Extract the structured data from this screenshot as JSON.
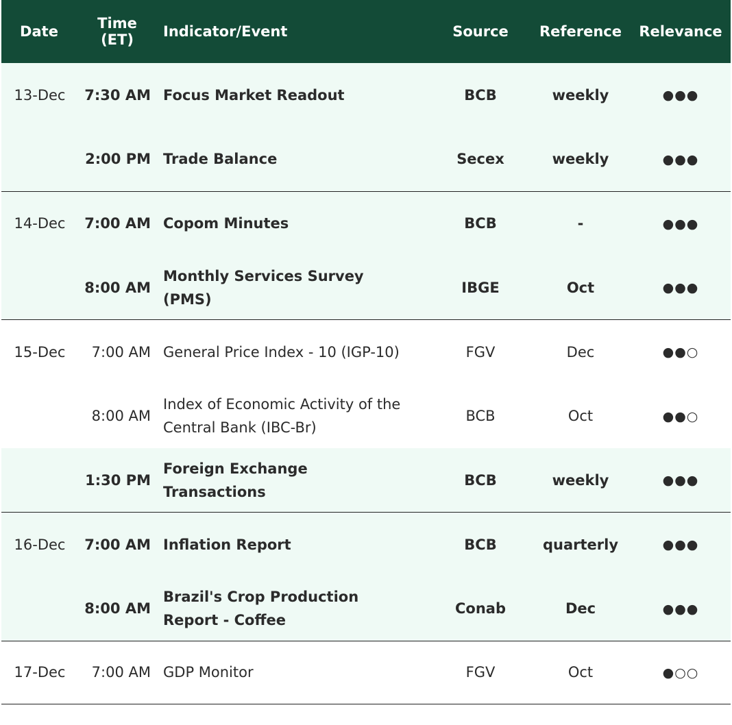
{
  "header": {
    "date": "Date",
    "time": "Time (ET)",
    "indicator": "Indicator/Event",
    "source": "Source",
    "reference": "Reference",
    "relevance": "Relevance"
  },
  "colors": {
    "header_bg": "#134b37",
    "highlight_bg": "#effaf5",
    "text": "#2b2b2b"
  },
  "rows": [
    {
      "date": "13-Dec",
      "time": "7:30 AM",
      "indicator": "Focus Market Readout",
      "source": "BCB",
      "reference": "weekly",
      "relevance": "●●●"
    },
    {
      "date": "",
      "time": "2:00 PM",
      "indicator": "Trade Balance",
      "source": "Secex",
      "reference": "weekly",
      "relevance": "●●●"
    },
    {
      "date": "14-Dec",
      "time": "7:00 AM",
      "indicator": "Copom Minutes",
      "source": "BCB",
      "reference": "-",
      "relevance": "●●●"
    },
    {
      "date": "",
      "time": "8:00 AM",
      "indicator": "Monthly Services Survey (PMS)",
      "source": "IBGE",
      "reference": "Oct",
      "relevance": "●●●"
    },
    {
      "date": "15-Dec",
      "time": "7:00 AM",
      "indicator": "General Price Index - 10 (IGP-10)",
      "source": "FGV",
      "reference": "Dec",
      "relevance": "●●○"
    },
    {
      "date": "",
      "time": "8:00 AM",
      "indicator": "Index of Economic Activity of the Central Bank (IBC-Br)",
      "source": "BCB",
      "reference": "Oct",
      "relevance": "●●○"
    },
    {
      "date": "",
      "time": "1:30 PM",
      "indicator": "Foreign Exchange Transactions",
      "source": "BCB",
      "reference": "weekly",
      "relevance": "●●●"
    },
    {
      "date": "16-Dec",
      "time": "7:00 AM",
      "indicator": "Inflation Report",
      "source": "BCB",
      "reference": "quarterly",
      "relevance": "●●●"
    },
    {
      "date": "",
      "time": "8:00 AM",
      "indicator": "Brazil's Crop Production Report - Coffee",
      "source": "Conab",
      "reference": "Dec",
      "relevance": "●●●"
    },
    {
      "date": "17-Dec",
      "time": "7:00 AM",
      "indicator": "GDP Monitor",
      "source": "FGV",
      "reference": "Oct",
      "relevance": "●○○"
    }
  ]
}
